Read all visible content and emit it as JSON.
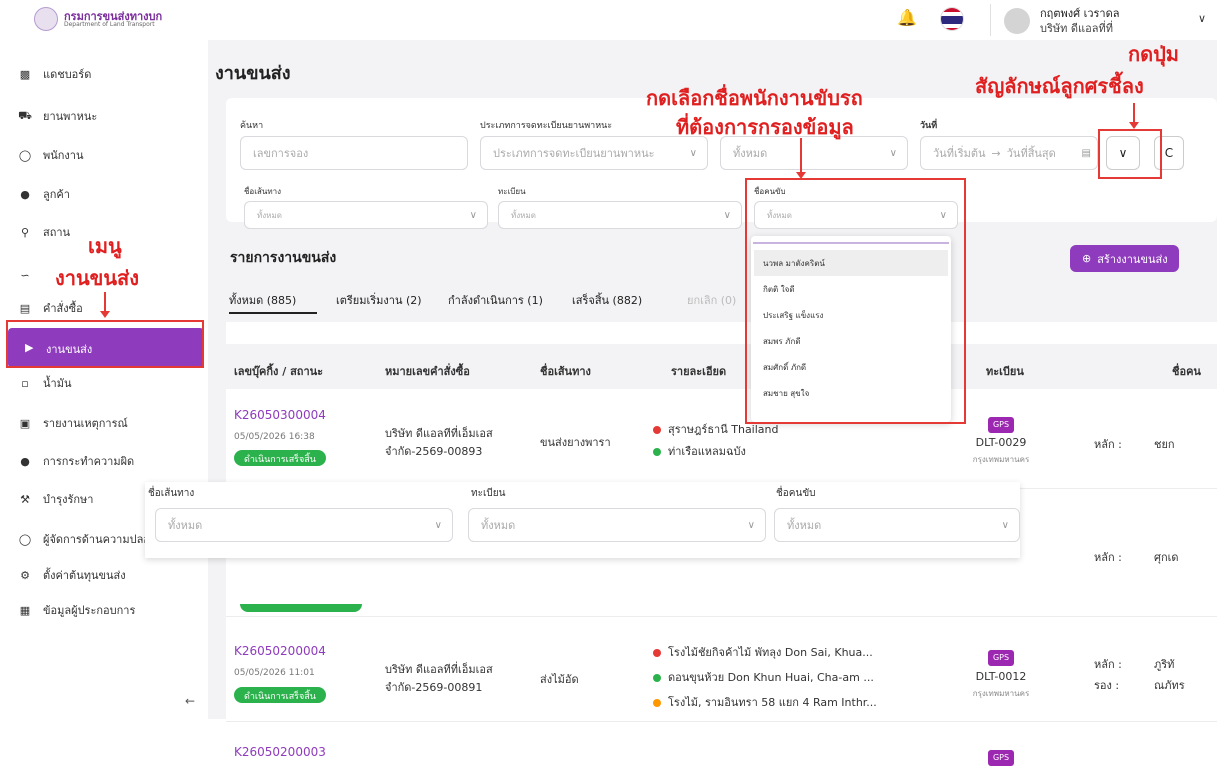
{
  "app": {
    "logo_th": "กรมการขนส่งทางบก",
    "logo_en": "Department of Land Transport"
  },
  "user": {
    "name": "กฤตพงศ์ เวราดล",
    "company": "บริษัท ดีแอลที่ที่"
  },
  "sidebar": {
    "items": [
      {
        "icon": "dashboard-icon",
        "label": "แดชบอร์ด"
      },
      {
        "icon": "truck-icon",
        "label": "ยานพาหนะ"
      },
      {
        "icon": "user-icon",
        "label": "พนักงาน"
      },
      {
        "icon": "customers-icon",
        "label": "ลูกค้า"
      },
      {
        "icon": "location-icon",
        "label": "สถาน"
      },
      {
        "icon": "route-icon",
        "label": ""
      },
      {
        "icon": "clipboard-icon",
        "label": "คำสั่งซื้อ"
      },
      {
        "icon": "shipping-icon",
        "label": "งานขนส่ง"
      },
      {
        "icon": "fuel-icon",
        "label": "น้ำมัน"
      },
      {
        "icon": "report-icon",
        "label": "รายงานเหตุการณ์"
      },
      {
        "icon": "violation-icon",
        "label": "การกระทำความผิด"
      },
      {
        "icon": "wrench-icon",
        "label": "บำรุงรักษา"
      },
      {
        "icon": "safety-manager-icon",
        "label": "ผู้จัดการด้านความปลอ"
      },
      {
        "icon": "gear-icon",
        "label": "ตั้งค่าต้นทุนขนส่ง"
      },
      {
        "icon": "building-icon",
        "label": "ข้อมูลผู้ประกอบการ"
      }
    ],
    "collapse": "←"
  },
  "page": {
    "title": "งานขนส่ง"
  },
  "filters": {
    "search_label": "ค้นหา",
    "search_placeholder": "เลขการจอง",
    "reg_type_label": "ประเภทการจดทะเบียนยานพาหนะ",
    "reg_type_placeholder": "ประเภทการจดทะเบียนยานพาหนะ",
    "all_placeholder": "ทั้งหมด",
    "date_label": "วันที่",
    "date_start": "วันที่เริ่มต้น",
    "date_arrow": "→",
    "date_end": "วันที่สิ้นสุด",
    "expand_symbol": "∨",
    "reset_symbol": "C",
    "route_label": "ชื่อเส้นทาง",
    "plate_label": "ทะเบียน",
    "driver_label": "ชื่อคนขับ"
  },
  "driver_dropdown": {
    "options": [
      "นวพล มาตังคริตน์",
      "กิตติ ใจดี",
      "ประเสริฐ แข็งแรง",
      "สมพร ภักดี",
      "สมศักดิ์ ภักดี",
      "สมชาย สุขใจ"
    ]
  },
  "list": {
    "title": "รายการงานขนส่ง",
    "create_button": "สร้างงานขนส่ง",
    "tabs": [
      "ทั้งหมด (885)",
      "เตรียมเริ่มงาน (2)",
      "กำลังดำเนินการ (1)",
      "เสร็จสิ้น (882)",
      "ยกเลิก (0)"
    ],
    "columns": [
      "เลขบุ๊คกิ้ง / สถานะ",
      "หมายเลขคำสั่งซื้อ",
      "ชื่อเส้นทาง",
      "รายละเอียด",
      "ทะเบียน",
      "ชื่อคน"
    ],
    "rows": [
      {
        "booking": "K26050300004",
        "date": "05/05/2026 16:38",
        "status": "ดำเนินการเสร็จสิ้น",
        "order1": "บริษัท ดีแอลทีที่เอ็มเอส",
        "order2": "จำกัด-2569-00893",
        "route": "ขนส่งยางพารา",
        "stops": [
          "สุราษฎร์ธานี Thailand",
          "ท่าเรือแหลมฉบัง"
        ],
        "gps": "GPS",
        "plate": "DLT-0029",
        "province": "กรุงเทพมหานคร",
        "driver_main_label": "หลัก :",
        "driver_main": "ชยก"
      },
      {
        "driver_main_label": "หลัก :",
        "driver_main": "ศุกเด"
      },
      {
        "booking": "K26050200004",
        "date": "05/05/2026 11:01",
        "status": "ดำเนินการเสร็จสิ้น",
        "order1": "บริษัท ดีแอลทีที่เอ็มเอส",
        "order2": "จำกัด-2569-00891",
        "route": "ส่งไม้อัด",
        "stops": [
          "โรงไม้ชัยกิจค้าไม้ พัทลุง Don Sai, Khua...",
          "ดอนขุนห้วย Don Khun Huai, Cha-am ...",
          "โรงไม้, รามอินทรา 58 แยก 4 Ram Inthr..."
        ],
        "gps": "GPS",
        "plate": "DLT-0012",
        "province": "กรุงเทพมหานคร",
        "driver_main_label": "หลัก :",
        "driver_main": "ภูริทั",
        "driver_sub_label": "รอง :",
        "driver_sub": "ณภัทร"
      },
      {
        "booking": "K26050200003"
      }
    ]
  },
  "annotations": {
    "driver_select": [
      "กดเลือกชื่อพนักงานขับรถ",
      "ที่ต้องการกรองข้อมูล"
    ],
    "arrow_button": [
      "กดปุ่ม",
      "สัญลักษณ์ลูกศรชี้ลง"
    ],
    "menu": [
      "เมนู",
      "งานขนส่ง"
    ]
  },
  "colors": {
    "accent": "#8e3bbd",
    "success": "#2bb24c",
    "annotation": "#e53935"
  }
}
